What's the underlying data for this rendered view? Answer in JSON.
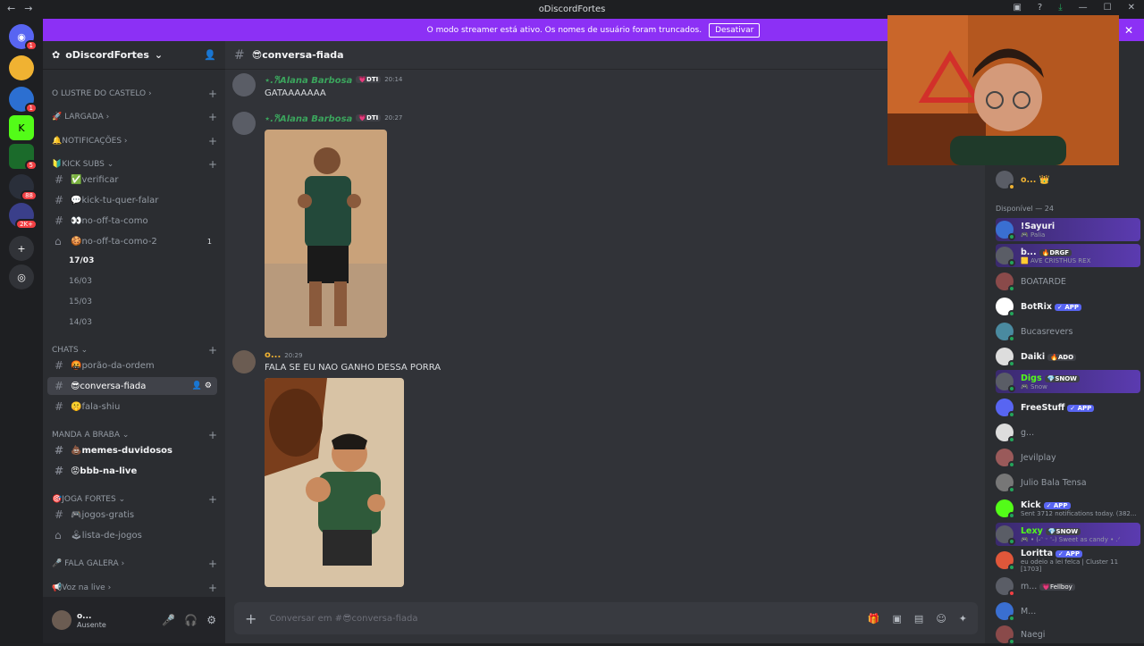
{
  "window": {
    "title": "oDiscordFortes"
  },
  "banner": {
    "text": "O modo streamer está ativo. Os nomes de usuário foram truncados.",
    "button": "Desativar"
  },
  "servers": [
    {
      "badge": "1"
    },
    {
      "badge": ""
    },
    {
      "badge": "1"
    },
    {
      "badge": ""
    },
    {
      "badge": "5"
    },
    {
      "badge": "88"
    },
    {
      "badge": "2K+"
    }
  ],
  "guild": {
    "name": "oDiscordFortes"
  },
  "categories": {
    "lustre": "O LUSTRE DO CASTELO",
    "largada": "🚀 LARGADA",
    "notificacoes": "🔔NOTIFICAÇÕES",
    "kicksubs": "🔰KICK SUBS",
    "chats": "CHATS",
    "mandabraba": "MANDA A BRABA",
    "jogafortes": "🎯JOGA FORTES",
    "falagalera": "🎤 FALA GALERA",
    "voznalive": "📢Voz na live"
  },
  "channels": {
    "verificar": "✅verificar",
    "kick": "💬kick-tu-quer-falar",
    "nooff": "👀no-off-ta-como",
    "nooff2": "🍪no-off-ta-como-2",
    "nooff2_count": "1",
    "porao": "🤬porão-da-ordem",
    "conversa": "😎conversa-fiada",
    "falashiu": "🤫fala-shiu",
    "memes": "💩memes-duvidosos",
    "bbb": "😡bbb-na-live",
    "jogos": "🎮jogos-gratis",
    "lista": "🕹lista-de-jogos"
  },
  "threads": [
    "17/03",
    "16/03",
    "15/03",
    "14/03"
  ],
  "user": {
    "name": "o...",
    "status": "Ausente"
  },
  "channel_header": {
    "name": "😎conversa-fiada"
  },
  "messages": [
    {
      "author": "⋆.𐙚Alana Barbosa",
      "tag": "💗DTI",
      "time": "20:14",
      "text": "GATAAAAAAA"
    },
    {
      "author": "⋆.𐙚Alana Barbosa",
      "tag": "💗DTI",
      "time": "20:27",
      "text": ""
    },
    {
      "author": "o...",
      "tag": "",
      "time": "20:29",
      "text": "FALA SE EU NAO GANHO DESSA PORRA"
    }
  ],
  "composer": {
    "placeholder": "Conversar em #😎conversa-fiada"
  },
  "members": {
    "top": "o... 👑",
    "heading": "Disponível — 24",
    "list": [
      {
        "name": "!Sayuri",
        "sub": "🎮 Palia",
        "tag": ""
      },
      {
        "name": "b...",
        "sub": "🟨 AVE CRISTHUS REX",
        "tag": "🔥DRGF"
      },
      {
        "name": "BOATARDE",
        "sub": "",
        "tag": ""
      },
      {
        "name": "BotRix",
        "sub": "",
        "tag": "✓ APP"
      },
      {
        "name": "Bucasrevers",
        "sub": "",
        "tag": ""
      },
      {
        "name": "Daiki",
        "sub": "",
        "tag": "🔥ADO"
      },
      {
        "name": "Digs",
        "sub": "🎮 Snow",
        "tag": "💎SNOW"
      },
      {
        "name": "FreeStuff",
        "sub": "",
        "tag": "✓ APP"
      },
      {
        "name": "g...",
        "sub": "",
        "tag": ""
      },
      {
        "name": "Jevilplay",
        "sub": "",
        "tag": ""
      },
      {
        "name": "Julio Bala Tensa",
        "sub": "",
        "tag": ""
      },
      {
        "name": "Kick",
        "sub": "Sent 3712 notifications today. (382...",
        "tag": "✓ APP"
      },
      {
        "name": "Lexy",
        "sub": "🎮 • (˶ᵔ ᵕ ᵔ˶) Sweet as candy • .ᐟ",
        "tag": "💎SNOW"
      },
      {
        "name": "Loritta",
        "sub": "eu odeio a lei felca | Cluster 11 [1703]",
        "tag": "✓ APP"
      },
      {
        "name": "m...",
        "sub": "",
        "tag": "💗Fellboy"
      },
      {
        "name": "M...",
        "sub": "",
        "tag": ""
      },
      {
        "name": "Naegi",
        "sub": "",
        "tag": ""
      }
    ]
  }
}
